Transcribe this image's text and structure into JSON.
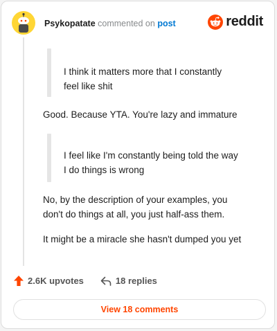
{
  "header": {
    "username": "Psykopatate",
    "action_text": "commented on",
    "post_link": "post",
    "brand": "reddit"
  },
  "comment": {
    "quote1": [
      "I think it matters more that I constantly",
      "feel like shit"
    ],
    "reply1": "Good. Because YTA. You're lazy and immature",
    "quote2": [
      "I feel like I'm constantly being told the way",
      "I do things is wrong"
    ],
    "reply2": [
      "No, by the description of your examples, you",
      "don't do things at all, you just half-ass them."
    ],
    "reply3": "It might be a miracle she hasn't dumped you yet"
  },
  "footer": {
    "upvotes": "2.6K upvotes",
    "replies": "18 replies",
    "view_comments": "View 18 comments"
  },
  "colors": {
    "accent": "#ff4500",
    "link": "#0079d3",
    "avatar_bg": "#ffd635"
  },
  "icons": [
    "avatar",
    "reddit-logo-icon",
    "upvote-arrow-icon",
    "reply-arrow-icon"
  ]
}
